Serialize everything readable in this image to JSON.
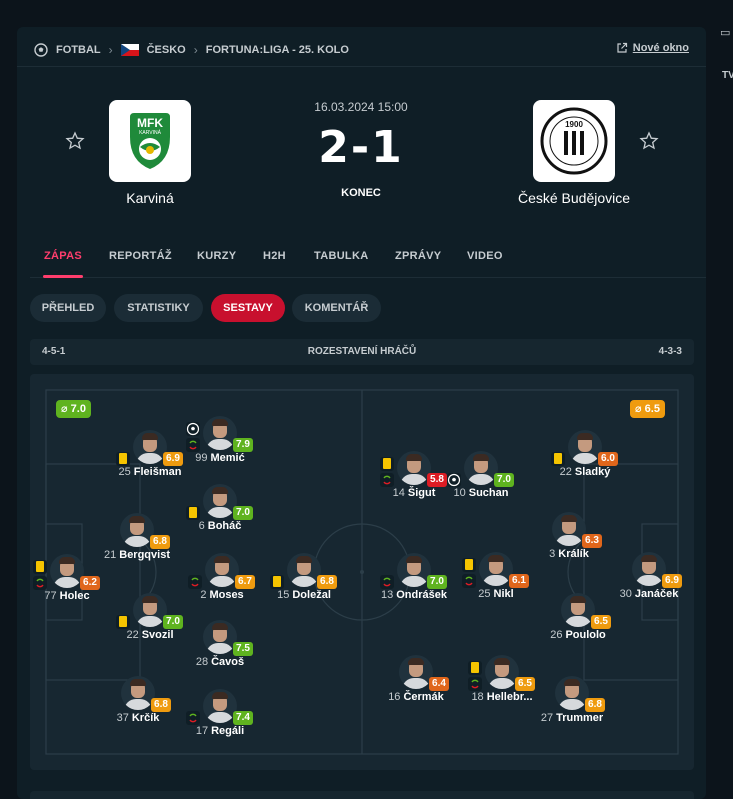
{
  "breadcrumb": {
    "sport": "FOTBAL",
    "country": "ČESKO",
    "league": "FORTUNA:LIGA - 25. KOLO"
  },
  "new_window": "Nové okno",
  "right_stub": "TV",
  "match": {
    "date": "16.03.2024 15:00",
    "score": "2-1",
    "status": "KONEC",
    "home": {
      "name": "Karviná",
      "logo_text": "MFK",
      "logo_sub": "KARVINÁ"
    },
    "away": {
      "name": "České Budějovice",
      "logo_text": "1900"
    }
  },
  "tabs": [
    "ZÁPAS",
    "REPORTÁŽ",
    "KURZY",
    "H2H",
    "TABULKA",
    "ZPRÁVY",
    "VIDEO"
  ],
  "subtabs": [
    "PŘEHLED",
    "STATISTIKY",
    "SESTAVY",
    "KOMENTÁŘ"
  ],
  "formation": {
    "home": "4-5-1",
    "title": "ROZESTAVENÍ HRÁČŮ",
    "away": "4-3-3"
  },
  "team_ratings": {
    "home": "⌀ 7.0",
    "away": "⌀ 6.5"
  },
  "colors": {
    "accent": "#ff3e6d",
    "active_pill": "#c8102e",
    "rating_green": "#5fb31f",
    "rating_orange": "#ef8f1b",
    "rating_red": "#dc1c24",
    "rating_darkgreen": "#3d9c28"
  },
  "players": [
    {
      "num": "25",
      "name": "Fleišman",
      "rating": "6.9",
      "rc": "orange",
      "yc": true
    },
    {
      "num": "99",
      "name": "Memić",
      "rating": "7.9",
      "rc": "green",
      "goal": true,
      "sub": true
    },
    {
      "num": "6",
      "name": "Boháč",
      "rating": "7.0",
      "rc": "green",
      "yc": true
    },
    {
      "num": "21",
      "name": "Bergqvist",
      "rating": "6.8",
      "rc": "orange"
    },
    {
      "num": "77",
      "name": "Holec",
      "rating": "6.2",
      "rc": "orange2",
      "yc": true,
      "sub": true
    },
    {
      "num": "2",
      "name": "Moses",
      "rating": "6.7",
      "rc": "orange",
      "sub": true
    },
    {
      "num": "15",
      "name": "Doležal",
      "rating": "6.8",
      "rc": "orange",
      "yc": true
    },
    {
      "num": "22",
      "name": "Svozil",
      "rating": "7.0",
      "rc": "green",
      "yc": true
    },
    {
      "num": "28",
      "name": "Čavoš",
      "rating": "7.5",
      "rc": "green"
    },
    {
      "num": "37",
      "name": "Krčík",
      "rating": "6.8",
      "rc": "orange"
    },
    {
      "num": "17",
      "name": "Regáli",
      "rating": "7.4",
      "rc": "green",
      "sub": true
    },
    {
      "num": "14",
      "name": "Šigut",
      "rating": "5.8",
      "rc": "red",
      "yc": true,
      "sub": true
    },
    {
      "num": "10",
      "name": "Suchan",
      "rating": "7.0",
      "rc": "green",
      "goal": true
    },
    {
      "num": "22",
      "name": "Sladký",
      "rating": "6.0",
      "rc": "orange2",
      "yc": true
    },
    {
      "num": "3",
      "name": "Králík",
      "rating": "6.3",
      "rc": "orange2"
    },
    {
      "num": "30",
      "name": "Janáček",
      "rating": "6.9",
      "rc": "orange"
    },
    {
      "num": "13",
      "name": "Ondrášek",
      "rating": "7.0",
      "rc": "green",
      "sub": true
    },
    {
      "num": "25",
      "name": "Nikl",
      "rating": "6.1",
      "rc": "orange2",
      "yc": true,
      "sub": true
    },
    {
      "num": "26",
      "name": "Poulolo",
      "rating": "6.5",
      "rc": "orange"
    },
    {
      "num": "16",
      "name": "Čermák",
      "rating": "6.4",
      "rc": "orange2"
    },
    {
      "num": "18",
      "name": "Hellebr...",
      "rating": "6.5",
      "rc": "orange",
      "yc": true,
      "sub": true
    },
    {
      "num": "27",
      "name": "Trummer",
      "rating": "6.8",
      "rc": "orange"
    }
  ]
}
